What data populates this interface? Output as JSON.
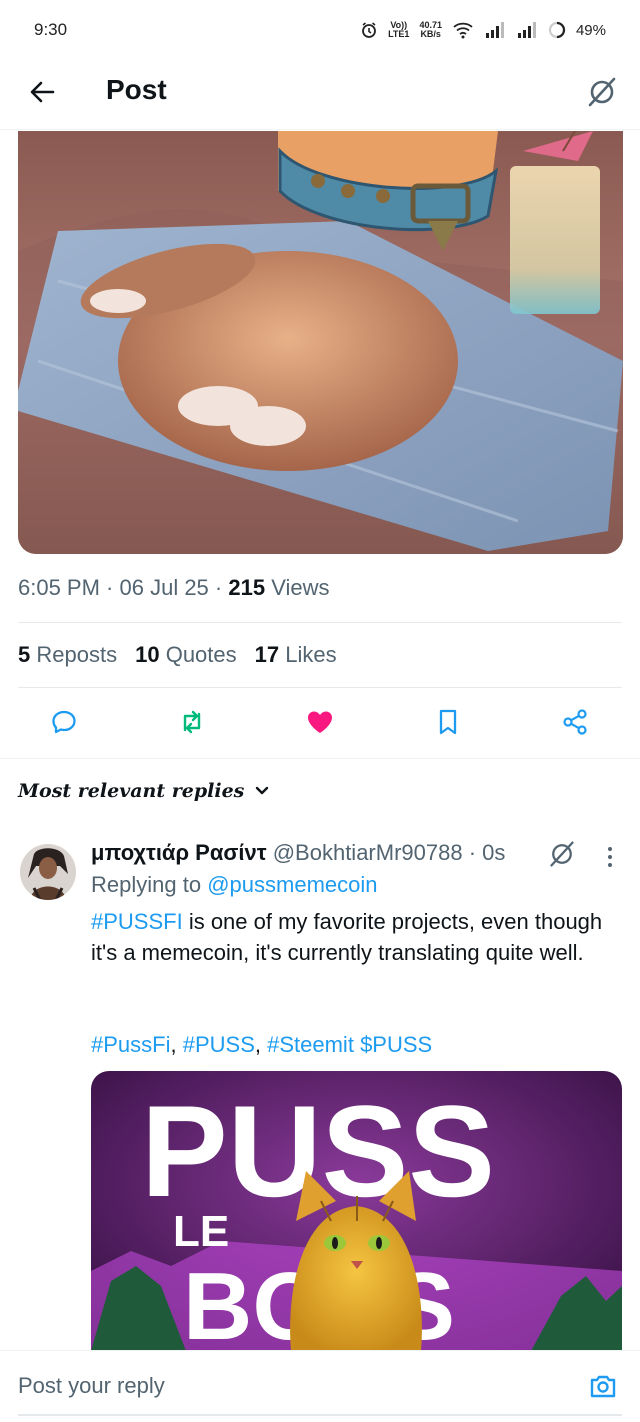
{
  "status_bar": {
    "time": "9:30",
    "network_top": "Vo))",
    "network_bottom": "LTE1",
    "speed_value": "40.71",
    "speed_unit": "KB/s",
    "battery": "49%"
  },
  "header": {
    "title": "Post"
  },
  "post": {
    "time": "6:05 PM",
    "date": "06 Jul 25",
    "views_count": "215",
    "views_label": "Views",
    "reposts_count": "5",
    "reposts_label": "Reposts",
    "quotes_count": "10",
    "quotes_label": "Quotes",
    "likes_count": "17",
    "likes_label": "Likes"
  },
  "replies": {
    "sort_label": "Most relevant replies",
    "items": [
      {
        "name": "μποχτιάρ Ρασίντ",
        "handle": "@BokhtiarMr90788",
        "time": "0s",
        "replying_prefix": "Replying to",
        "replying_to": "@pussmemecoin",
        "hashtag_lead": "#PUSSFI",
        "text": " is one of my favorite projects, even though it's a memecoin, it's currently translating quite well.",
        "tag1": "#PussFi",
        "tag2": "#PUSS",
        "tag3": "#Steemit",
        "cashtag": "$PUSS",
        "media_text_top": "PUSS",
        "media_text_mid": "LE",
        "media_text_bottom": "BOSS"
      }
    ]
  },
  "composer": {
    "placeholder": "Post your reply"
  },
  "colors": {
    "accent": "#1d9bf0",
    "repost_green": "#00ba7c",
    "like_pink": "#f91880",
    "text_primary": "#0f1419",
    "text_secondary": "#536471"
  }
}
